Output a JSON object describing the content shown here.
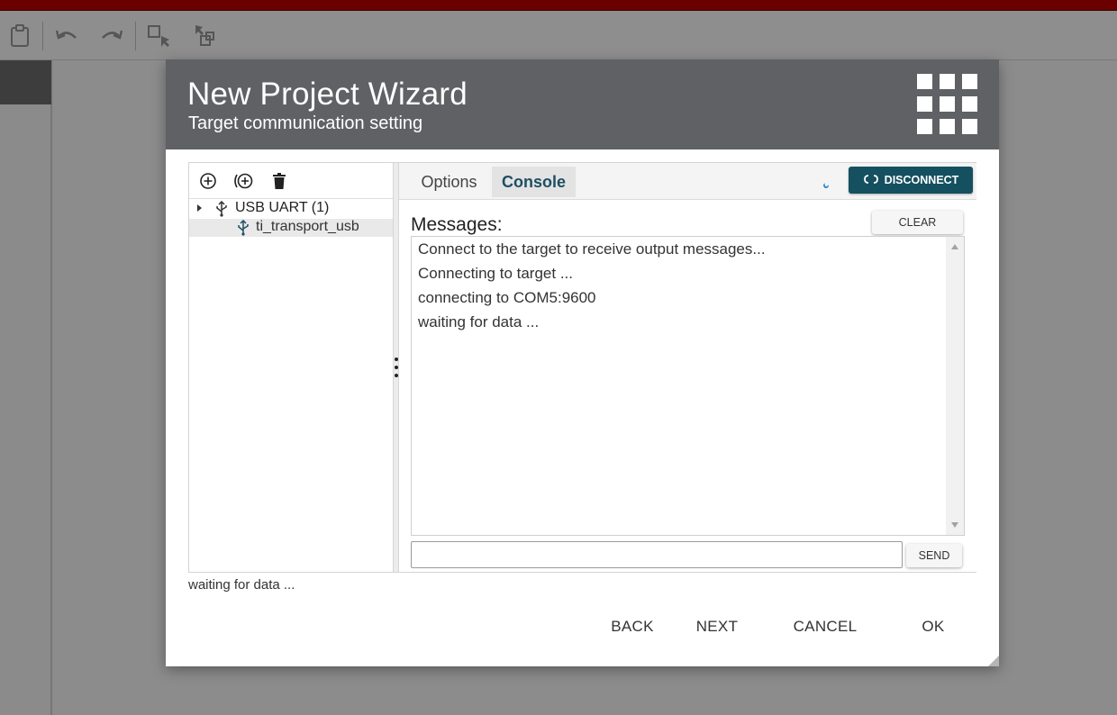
{
  "dialog": {
    "title": "New Project Wizard",
    "subtitle": "Target communication setting"
  },
  "tree": {
    "toolbar_icons": [
      "add-circle-icon",
      "add-connection-icon",
      "delete-icon"
    ],
    "items": [
      {
        "label": "USB UART (1)",
        "icon": "usb-icon",
        "expanded": false
      },
      {
        "label": "ti_transport_usb",
        "icon": "usb-icon",
        "selected": true
      }
    ]
  },
  "tabs": [
    {
      "label": "Options",
      "active": false
    },
    {
      "label": "Console",
      "active": true
    }
  ],
  "console": {
    "disconnect_label": "DISCONNECT",
    "messages_label": "Messages:",
    "clear_label": "CLEAR",
    "messages": [
      "Connect to the target to receive output messages...",
      "Connecting to target ...",
      "connecting to COM5:9600",
      "waiting for data ..."
    ],
    "input_value": "",
    "send_label": "SEND"
  },
  "status_text": "waiting for data ...",
  "footer": {
    "back_label": "BACK",
    "next_label": "NEXT",
    "cancel_label": "CANCEL",
    "ok_label": "OK"
  },
  "colors": {
    "header_bg": "#5f6165",
    "accent": "#14505f",
    "active_tab_text": "#1c4f63",
    "app_topbar": "#6b0000"
  }
}
